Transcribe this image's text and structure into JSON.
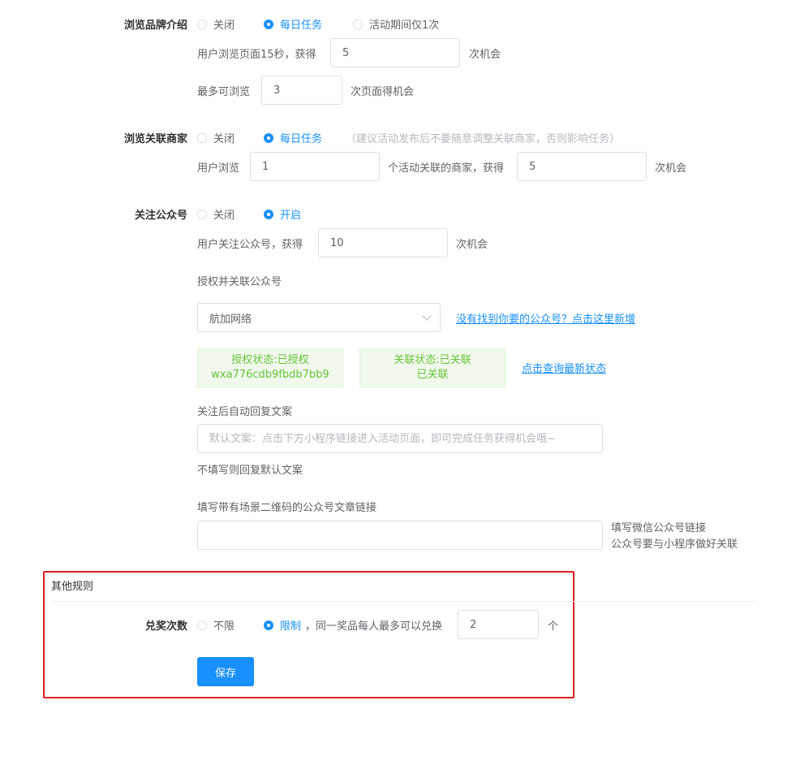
{
  "brand_intro": {
    "label": "浏览品牌介绍",
    "options": [
      "关闭",
      "每日任务",
      "活动期间仅1次"
    ],
    "selected": 1,
    "browse_text": "用户浏览页面15秒，获得",
    "browse_value": "5",
    "browse_suffix": "次机会",
    "max_text": "最多可浏览",
    "max_value": "3",
    "max_suffix": "次页面得机会"
  },
  "merchants": {
    "label": "浏览关联商家",
    "options": [
      "关闭",
      "每日任务"
    ],
    "selected": 1,
    "hint": "（建议活动发布后不要随意调整关联商家，否则影响任务）",
    "prefix": "用户浏览",
    "count_value": "1",
    "middle": "个活动关联的商家，获得",
    "chance_value": "5",
    "suffix": "次机会"
  },
  "follow": {
    "label": "关注公众号",
    "options": [
      "关闭",
      "开启"
    ],
    "selected": 1,
    "follow_text": "用户关注公众号，获得",
    "follow_value": "10",
    "follow_suffix": "次机会",
    "auth_title": "授权并关联公众号",
    "account_selected": "航加网络",
    "add_link": "没有找到你要的公众号？点击这里新增",
    "auth_status_line1": "授权状态:已授权",
    "auth_status_line2": "wxa776cdb9fbdb7bb9",
    "link_status_line1": "关联状态:已关联",
    "link_status_line2": "已关联",
    "refresh_link": "点击查询最新状态",
    "reply_title": "关注后自动回复文案",
    "reply_placeholder": "默认文案：点击下方小程序链接进入活动页面，即可完成任务获得机会哦~",
    "reply_note": "不填写则回复默认文案",
    "article_title": "填写带有场景二维码的公众号文章链接",
    "article_value": "",
    "article_hint1": "填写微信公众号链接",
    "article_hint2": "公众号要与小程序做好关联"
  },
  "other_rules": {
    "section_title": "其他规则",
    "label": "兑奖次数",
    "options": [
      "不限",
      "限制"
    ],
    "selected": 1,
    "limit_text": "，同一奖品每人最多可以兑换",
    "limit_value": "2",
    "limit_suffix": "个",
    "save_label": "保存"
  },
  "colors": {
    "accent": "#1890ff",
    "highlight_frame": "#e02020",
    "status_green": "#67c23a"
  }
}
